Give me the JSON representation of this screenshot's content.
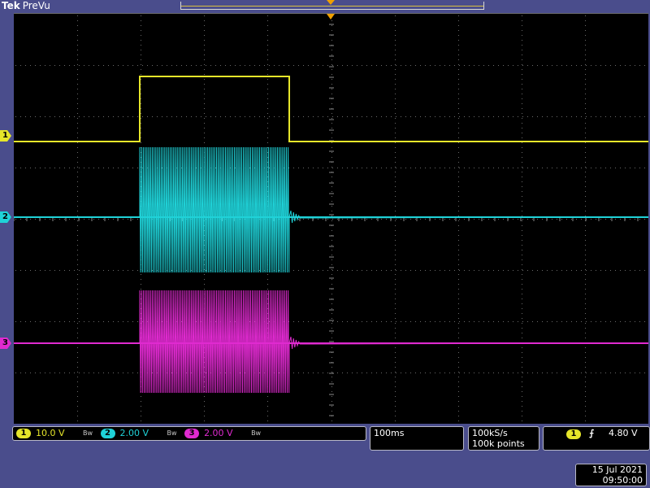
{
  "header": {
    "brand": "Tek",
    "mode": "PreVu"
  },
  "colors": {
    "ch1": "#e6e62a",
    "ch2": "#1fd2d8",
    "ch3": "#e02ad0",
    "background": "#000000",
    "frame": "#4a4d8c",
    "trigger": "#f0a000"
  },
  "channels": [
    {
      "number": "1",
      "scale": "10.0 V"
    },
    {
      "number": "2",
      "scale": "2.00 V"
    },
    {
      "number": "3",
      "scale": "2.00 V"
    }
  ],
  "bandwidth_icon": "bw-limit-icon",
  "timebase": {
    "value": "100ms"
  },
  "acquisition": {
    "rate": "100kS/s",
    "points": "100k points"
  },
  "trigger": {
    "source": "1",
    "slope_icon": "rising-edge-icon",
    "slope": "⨍",
    "level": "4.80 V"
  },
  "datetime": {
    "date": "15 Jul   2021",
    "time": "09:50:00"
  }
}
